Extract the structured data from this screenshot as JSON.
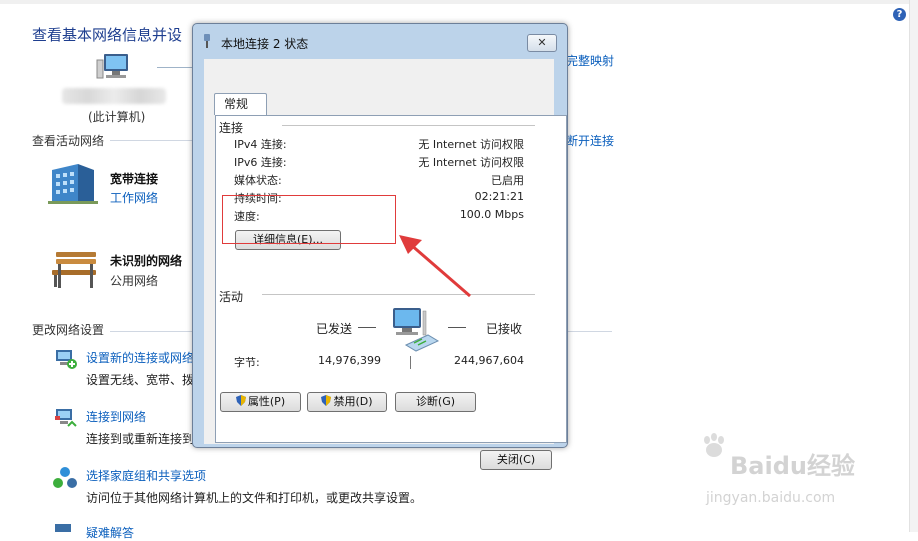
{
  "page": {
    "title": "查看基本网络信息并设",
    "map_link": "完整映射",
    "computer_label": "(此计算机)",
    "active_networks_title": "查看活动网络",
    "disconnect_link": "断开连接",
    "change_settings_title": "更改网络设置"
  },
  "networks": [
    {
      "name": "宽带连接",
      "type": "工作网络"
    },
    {
      "name": "未识别的网络",
      "type": "公用网络"
    }
  ],
  "tasks": [
    {
      "link": "设置新的连接或网络",
      "desc": "设置无线、宽带、拨"
    },
    {
      "link": "连接到网络",
      "desc": "连接到或重新连接到"
    },
    {
      "link": "选择家庭组和共享选项",
      "desc": "访问位于其他网络计算机上的文件和打印机，或更改共享设置。"
    },
    {
      "link": "疑难解答",
      "desc": ""
    }
  ],
  "dialog": {
    "title": "本地连接 2 状态",
    "close_x": "✕",
    "tab": "常规",
    "connection_group": "连接",
    "rows": [
      {
        "label": "IPv4 连接:",
        "value": "无 Internet 访问权限"
      },
      {
        "label": "IPv6 连接:",
        "value": "无 Internet 访问权限"
      },
      {
        "label": "媒体状态:",
        "value": "已启用"
      },
      {
        "label": "持续时间:",
        "value": "02:21:21"
      },
      {
        "label": "速度:",
        "value": "100.0 Mbps"
      }
    ],
    "details_button": "详细信息(E)...",
    "activity_group": "活动",
    "sent_label": "已发送",
    "received_label": "已接收",
    "bytes_label": "字节:",
    "bytes_sent": "14,976,399",
    "bytes_received": "244,967,604",
    "properties_button": "属性(P)",
    "disable_button": "禁用(D)",
    "diagnose_button": "诊断(G)",
    "close_button": "关闭(C)"
  },
  "watermark": {
    "brand": "Baidu经验",
    "url": "jingyan.baidu.com"
  },
  "colors": {
    "link": "#0b5fbd",
    "title": "#1e3e8f",
    "annotation": "#e03b3b",
    "dialog_frame": "#bcd3ea"
  }
}
